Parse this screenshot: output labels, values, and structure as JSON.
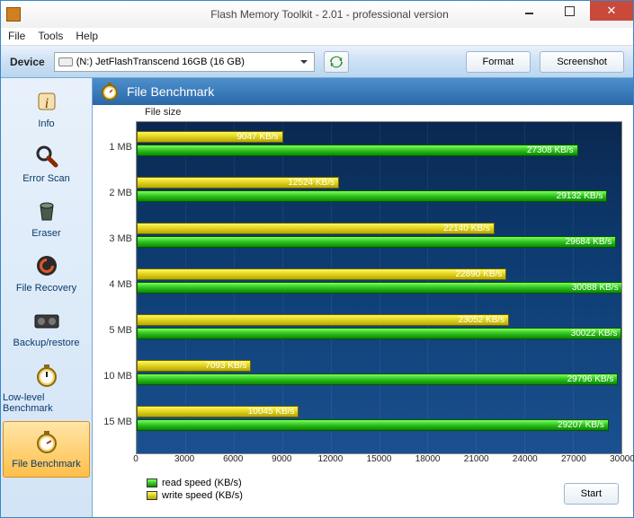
{
  "window": {
    "title": "Flash Memory Toolkit - 2.01 - professional version"
  },
  "menu": {
    "file": "File",
    "tools": "Tools",
    "help": "Help"
  },
  "toolbar": {
    "device_label": "Device",
    "device_value": "(N:) JetFlashTranscend 16GB (16 GB)",
    "format": "Format",
    "screenshot": "Screenshot"
  },
  "sidebar": {
    "items": [
      {
        "label": "Info"
      },
      {
        "label": "Error Scan"
      },
      {
        "label": "Eraser"
      },
      {
        "label": "File Recovery"
      },
      {
        "label": "Backup/restore"
      },
      {
        "label": "Low-level Benchmark"
      },
      {
        "label": "File Benchmark"
      }
    ]
  },
  "panel": {
    "title": "File Benchmark",
    "ylabel": "File size"
  },
  "legend": {
    "read": "read speed (KB/s)",
    "write": "write speed (KB/s)"
  },
  "start": "Start",
  "chart_data": {
    "type": "bar",
    "orientation": "horizontal",
    "categories": [
      "1 MB",
      "2 MB",
      "3 MB",
      "4 MB",
      "5 MB",
      "10 MB",
      "15 MB"
    ],
    "series": [
      {
        "name": "write speed (KB/s)",
        "values": [
          9047,
          12524,
          22140,
          22890,
          23052,
          7093,
          10045
        ],
        "color": "#e6d800"
      },
      {
        "name": "read speed (KB/s)",
        "values": [
          27308,
          29132,
          29684,
          30088,
          30022,
          29796,
          29207
        ],
        "color": "#1db000"
      }
    ],
    "xlim": [
      0,
      30000
    ],
    "xticks": [
      0,
      3000,
      6000,
      9000,
      12000,
      15000,
      18000,
      21000,
      24000,
      27000,
      30000
    ],
    "title": "File Benchmark",
    "ylabel": "File size",
    "value_suffix": " KB/s"
  }
}
